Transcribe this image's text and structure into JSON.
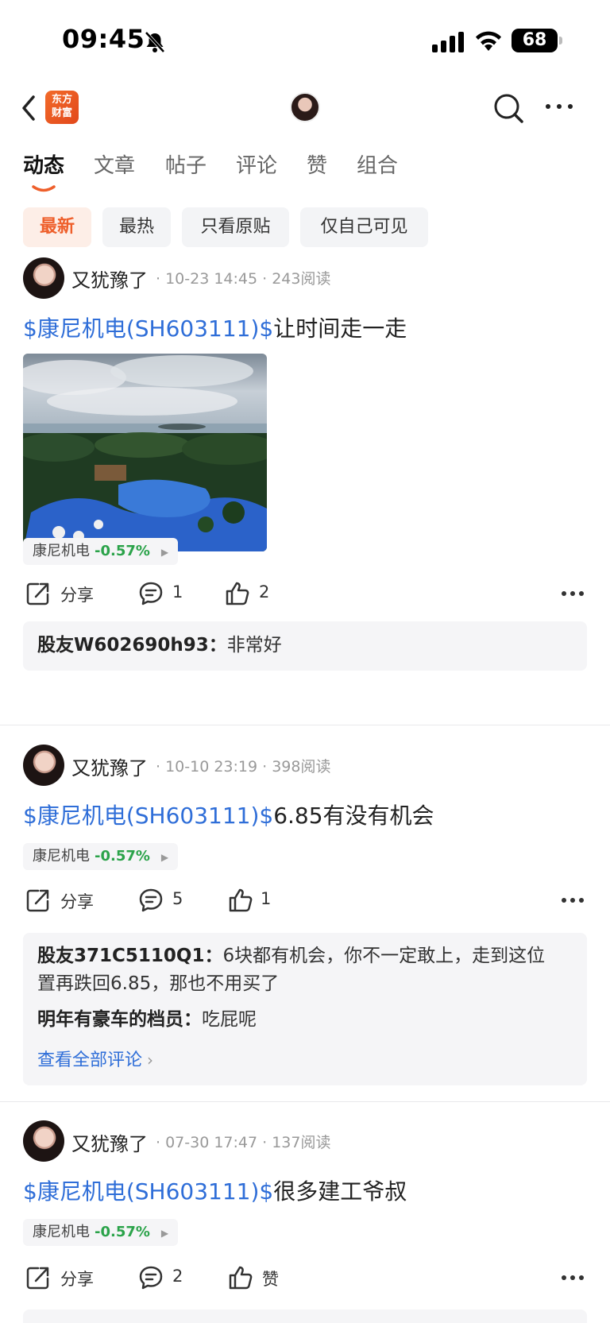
{
  "status_bar": {
    "time": "09:45",
    "battery": "68",
    "icons": [
      "bell-slash-icon",
      "cellular-signal-icon",
      "wifi-icon",
      "battery-icon"
    ]
  },
  "nav": {
    "logo_line1": "东方",
    "logo_line2": "财富",
    "icons": [
      "back-icon",
      "search-icon",
      "more-icon"
    ]
  },
  "tabs": [
    {
      "label": "动态",
      "active": true
    },
    {
      "label": "文章"
    },
    {
      "label": "帖子"
    },
    {
      "label": "评论"
    },
    {
      "label": "赞"
    },
    {
      "label": "组合"
    }
  ],
  "filters": [
    {
      "label": "最新",
      "active": true
    },
    {
      "label": "最热"
    },
    {
      "label": "只看原贴"
    },
    {
      "label": "仅自己可见"
    }
  ],
  "colors": {
    "accent": "#ee5f2b",
    "link": "#2f6ed8",
    "down_green": "#2ba34a"
  },
  "posts": [
    {
      "author": "又犹豫了",
      "meta": "· 10-23 14:45 · 243阅读",
      "stock_tag": "$康尼机电(SH603111)$",
      "text": "让时间走一走",
      "quote_name": "康尼机电",
      "quote_change": "-0.57%",
      "share": "分享",
      "comments": "1",
      "likes": "2",
      "comment_list": [
        {
          "name": "股友W602690h93：",
          "text": "非常好"
        }
      ]
    },
    {
      "author": "又犹豫了",
      "meta": "· 10-10 23:19 · 398阅读",
      "stock_tag": "$康尼机电(SH603111)$",
      "text": "6.85有没有机会",
      "quote_name": "康尼机电",
      "quote_change": "-0.57%",
      "share": "分享",
      "comments": "5",
      "likes": "1",
      "comment_list": [
        {
          "name": "股友371C5110Q1：",
          "text": "6块都有机会，你不一定敢上，走到这位",
          "text2": "置再跌回6.85，那也不用买了"
        },
        {
          "name": "明年有豪车的档员：",
          "text": "吃屁呢"
        }
      ],
      "view_all": "查看全部评论"
    },
    {
      "author": "又犹豫了",
      "meta": "· 07-30 17:47 · 137阅读",
      "stock_tag": "$康尼机电(SH603111)$",
      "text": "很多建工爷叔",
      "quote_name": "康尼机电",
      "quote_change": "-0.57%",
      "share": "分享",
      "comments": "2",
      "likes": "赞"
    }
  ]
}
